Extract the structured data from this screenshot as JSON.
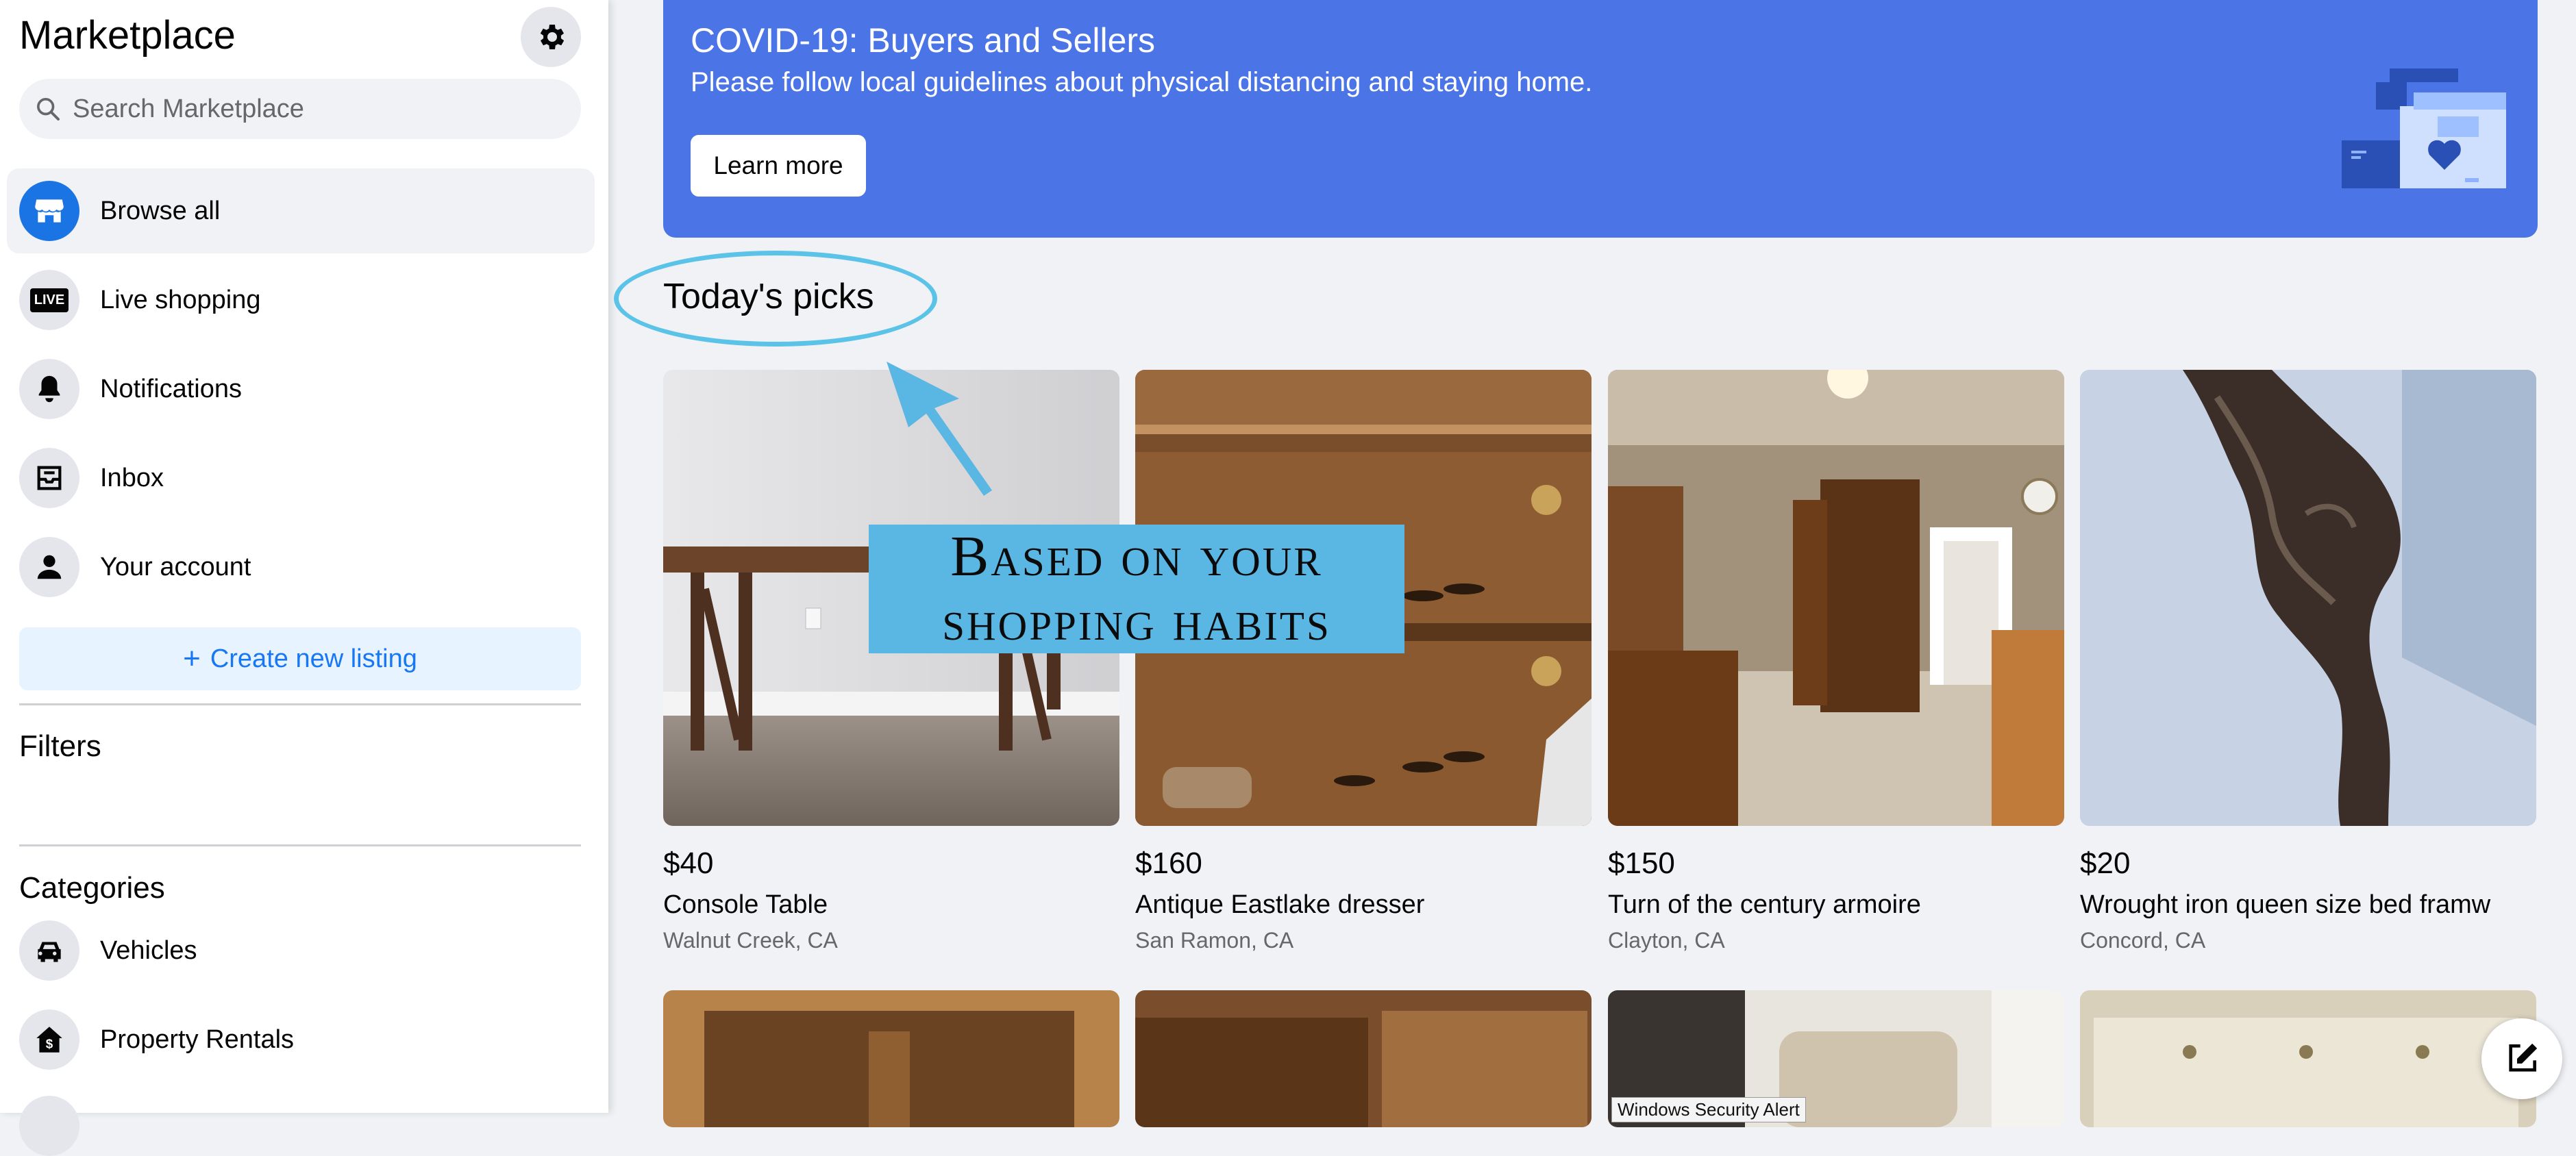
{
  "sidebar": {
    "title": "Marketplace",
    "search_placeholder": "Search Marketplace",
    "nav": [
      {
        "label": "Browse all",
        "icon": "storefront-icon"
      },
      {
        "label": "Live shopping",
        "icon": "live-icon",
        "badge": "LIVE"
      },
      {
        "label": "Notifications",
        "icon": "bell-icon"
      },
      {
        "label": "Inbox",
        "icon": "inbox-icon"
      },
      {
        "label": "Your account",
        "icon": "person-icon"
      }
    ],
    "create_listing": "Create new listing",
    "create_icon": "+",
    "filters_title": "Filters",
    "categories_title": "Categories",
    "categories": [
      {
        "label": "Vehicles",
        "icon": "car-icon"
      },
      {
        "label": "Property Rentals",
        "icon": "house-dollar-icon"
      }
    ]
  },
  "banner": {
    "title": "COVID-19: Buyers and Sellers",
    "text": "Please follow local guidelines about physical distancing and staying home.",
    "button": "Learn more",
    "color": "#4b75e6"
  },
  "main": {
    "section_title": "Today's picks",
    "callout_line1": "Based on your",
    "callout_line2": "shopping habits",
    "listings": [
      {
        "price": "$40",
        "title": "Console Table",
        "location": "Walnut Creek, CA"
      },
      {
        "price": "$160",
        "title": "Antique Eastlake dresser",
        "location": "San Ramon, CA"
      },
      {
        "price": "$150",
        "title": "Turn of the century armoire",
        "location": "Clayton, CA"
      },
      {
        "price": "$20",
        "title": "Wrought iron queen size bed framw",
        "location": "Concord, CA"
      }
    ],
    "overlay_alert": "Windows Security Alert"
  },
  "colors": {
    "accent": "#1877f2",
    "highlight": "#5bc3e8",
    "callout_bg": "#5ab6e3"
  }
}
